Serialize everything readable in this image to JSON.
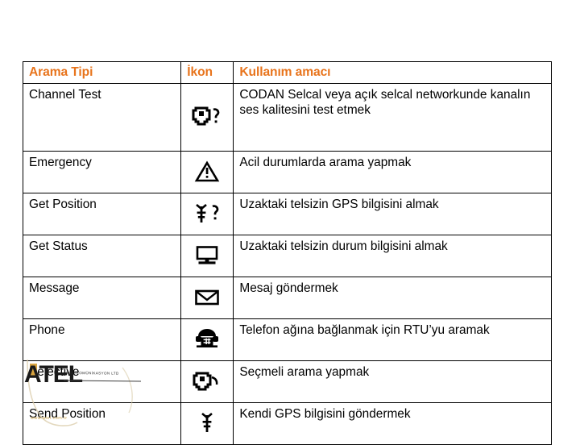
{
  "table": {
    "headers": {
      "type": "Arama Tipi",
      "icon": "İkon",
      "usage": "Kullanım amacı"
    },
    "accent_color": "#E8741C",
    "border_color": "#000000",
    "rows": [
      {
        "type": "Channel Test",
        "icon": "handset-question-icon",
        "usage": "CODAN Selcal veya açık selcal networkunde kanalın ses kalitesini test etmek"
      },
      {
        "type": "Emergency",
        "icon": "warning-triangle-icon",
        "usage": "Acil durumlarda arama yapmak"
      },
      {
        "type": "Get Position",
        "icon": "gps-satellite-question-icon",
        "usage": "Uzaktaki telsizin GPS bilgisini almak"
      },
      {
        "type": "Get Status",
        "icon": "computer-monitor-icon",
        "usage": "Uzaktaki telsizin durum bilgisini almak"
      },
      {
        "type": "Message",
        "icon": "envelope-icon",
        "usage": "Mesaj göndermek"
      },
      {
        "type": "Phone",
        "icon": "telephone-icon",
        "usage": "Telefon ağına bağlanmak için RTU’yu aramak"
      },
      {
        "type": "Selective",
        "icon": "handset-signal-icon",
        "usage": "Seçmeli arama yapmak"
      },
      {
        "type": "Send Position",
        "icon": "gps-satellite-icon",
        "usage": "Kendi GPS bilgisini göndermek"
      }
    ]
  },
  "logo": {
    "wordmark": "ATEL",
    "tagline": "TELEKOMÜNİKASYON LTD",
    "url": "www.atel.com.tr",
    "accent_color": "#D9A441"
  }
}
